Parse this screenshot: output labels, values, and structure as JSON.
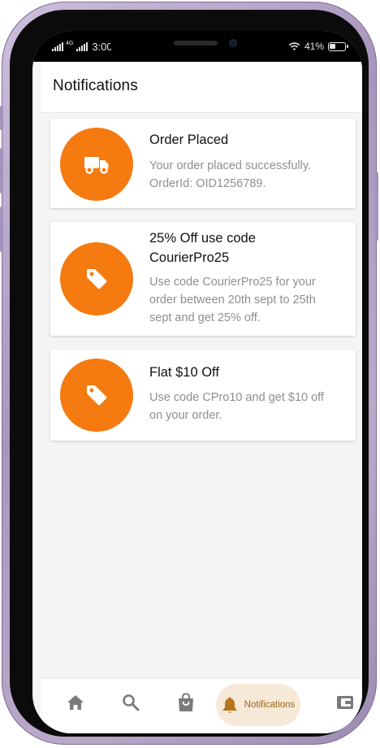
{
  "status_bar": {
    "network": "4G",
    "time": "3:00",
    "battery": "41%",
    "battery_level": 0.41
  },
  "header": {
    "title": "Notifications"
  },
  "notifications": [
    {
      "icon": "truck-icon",
      "title_lines": [
        "Order Placed"
      ],
      "body_lines": [
        "Your order placed successfully.",
        "OrderId: OID1256789."
      ]
    },
    {
      "icon": "tag-icon",
      "title_lines": [
        "25% Off use code",
        "CourierPro25"
      ],
      "body_lines": [
        "Use code CourierPro25 for your",
        "order between 20th sept to 25th",
        "sept and get 25% off."
      ]
    },
    {
      "icon": "tag-icon",
      "title_lines": [
        "Flat $10 Off"
      ],
      "body_lines": [
        "Use code CPro10 and get $10 off",
        "on your order."
      ]
    }
  ],
  "bottom_nav": {
    "items": [
      {
        "icon": "home-icon",
        "label": ""
      },
      {
        "icon": "search-icon",
        "label": ""
      },
      {
        "icon": "shopping-bag-icon",
        "label": ""
      },
      {
        "icon": "bell-icon",
        "label": "Notifications",
        "active": true
      },
      {
        "icon": "wallet-icon",
        "label": ""
      }
    ]
  },
  "colors": {
    "accent": "#f57a10",
    "active_nav_bg": "#f7e9d8",
    "active_nav_text": "#9a6417",
    "icon_gray": "#7a7a7a",
    "phone_frame": "#b3a4c7"
  }
}
